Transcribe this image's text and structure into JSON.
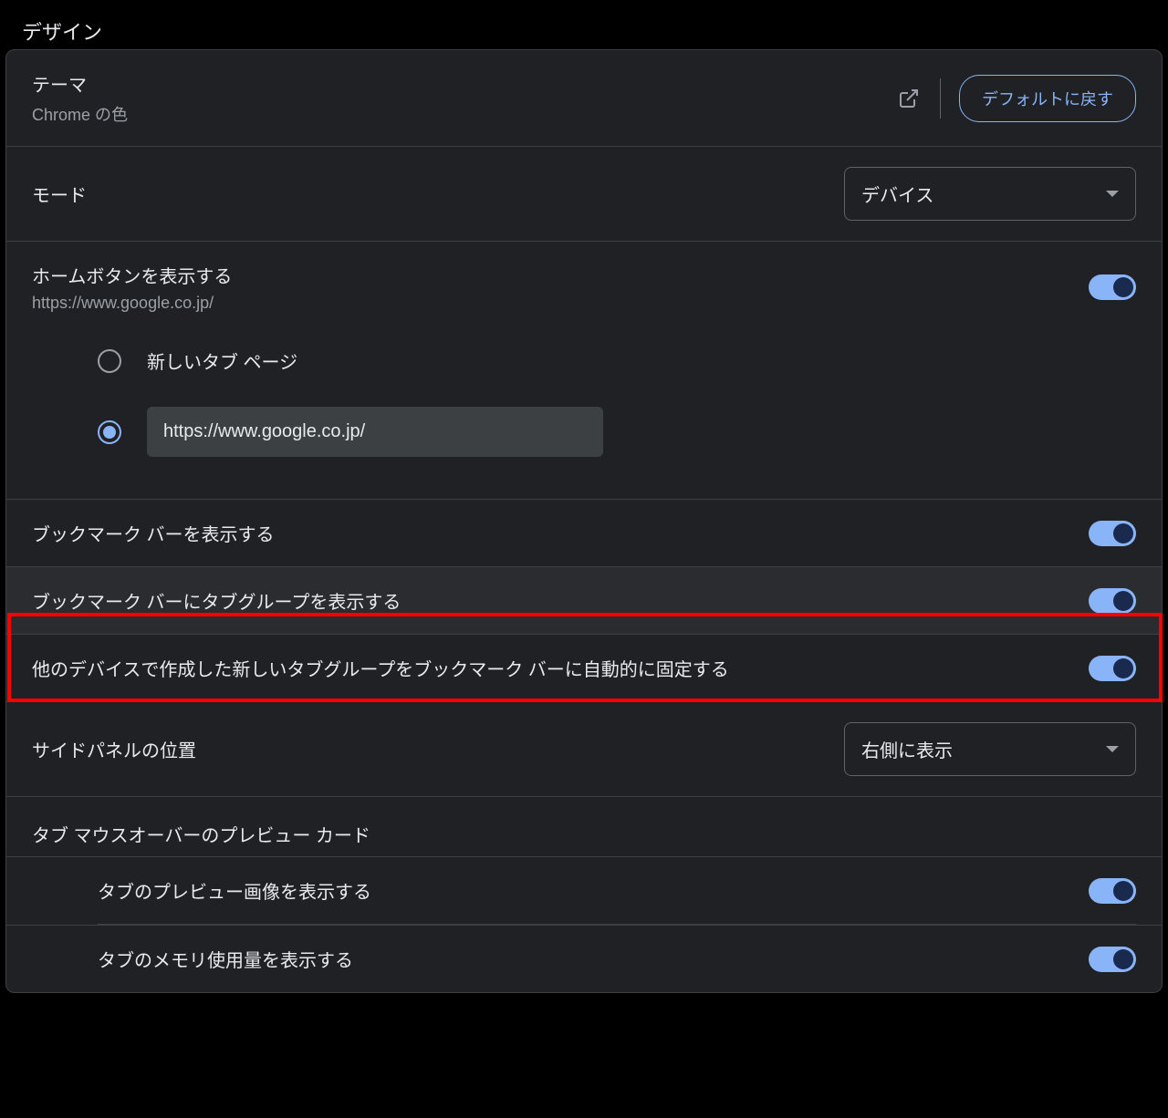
{
  "section_title": "デザイン",
  "theme": {
    "label": "テーマ",
    "sublabel": "Chrome の色",
    "reset_button": "デフォルトに戻す"
  },
  "mode": {
    "label": "モード",
    "selected": "デバイス"
  },
  "home_button": {
    "label": "ホームボタンを表示する",
    "sublabel": "https://www.google.co.jp/",
    "radio_new_tab": "新しいタブ ページ",
    "radio_url_value": "https://www.google.co.jp/"
  },
  "bookmark_bar": {
    "label": "ブックマーク バーを表示する"
  },
  "tab_groups_bookmark_bar": {
    "label": "ブックマーク バーにタブグループを表示する"
  },
  "auto_pin_tab_groups": {
    "label": "他のデバイスで作成した新しいタブグループをブックマーク バーに自動的に固定する"
  },
  "side_panel": {
    "label": "サイドパネルの位置",
    "selected": "右側に表示"
  },
  "tab_hover": {
    "title": "タブ マウスオーバーのプレビュー カード",
    "preview_image": "タブのプレビュー画像を表示する",
    "memory_usage": "タブのメモリ使用量を表示する"
  }
}
